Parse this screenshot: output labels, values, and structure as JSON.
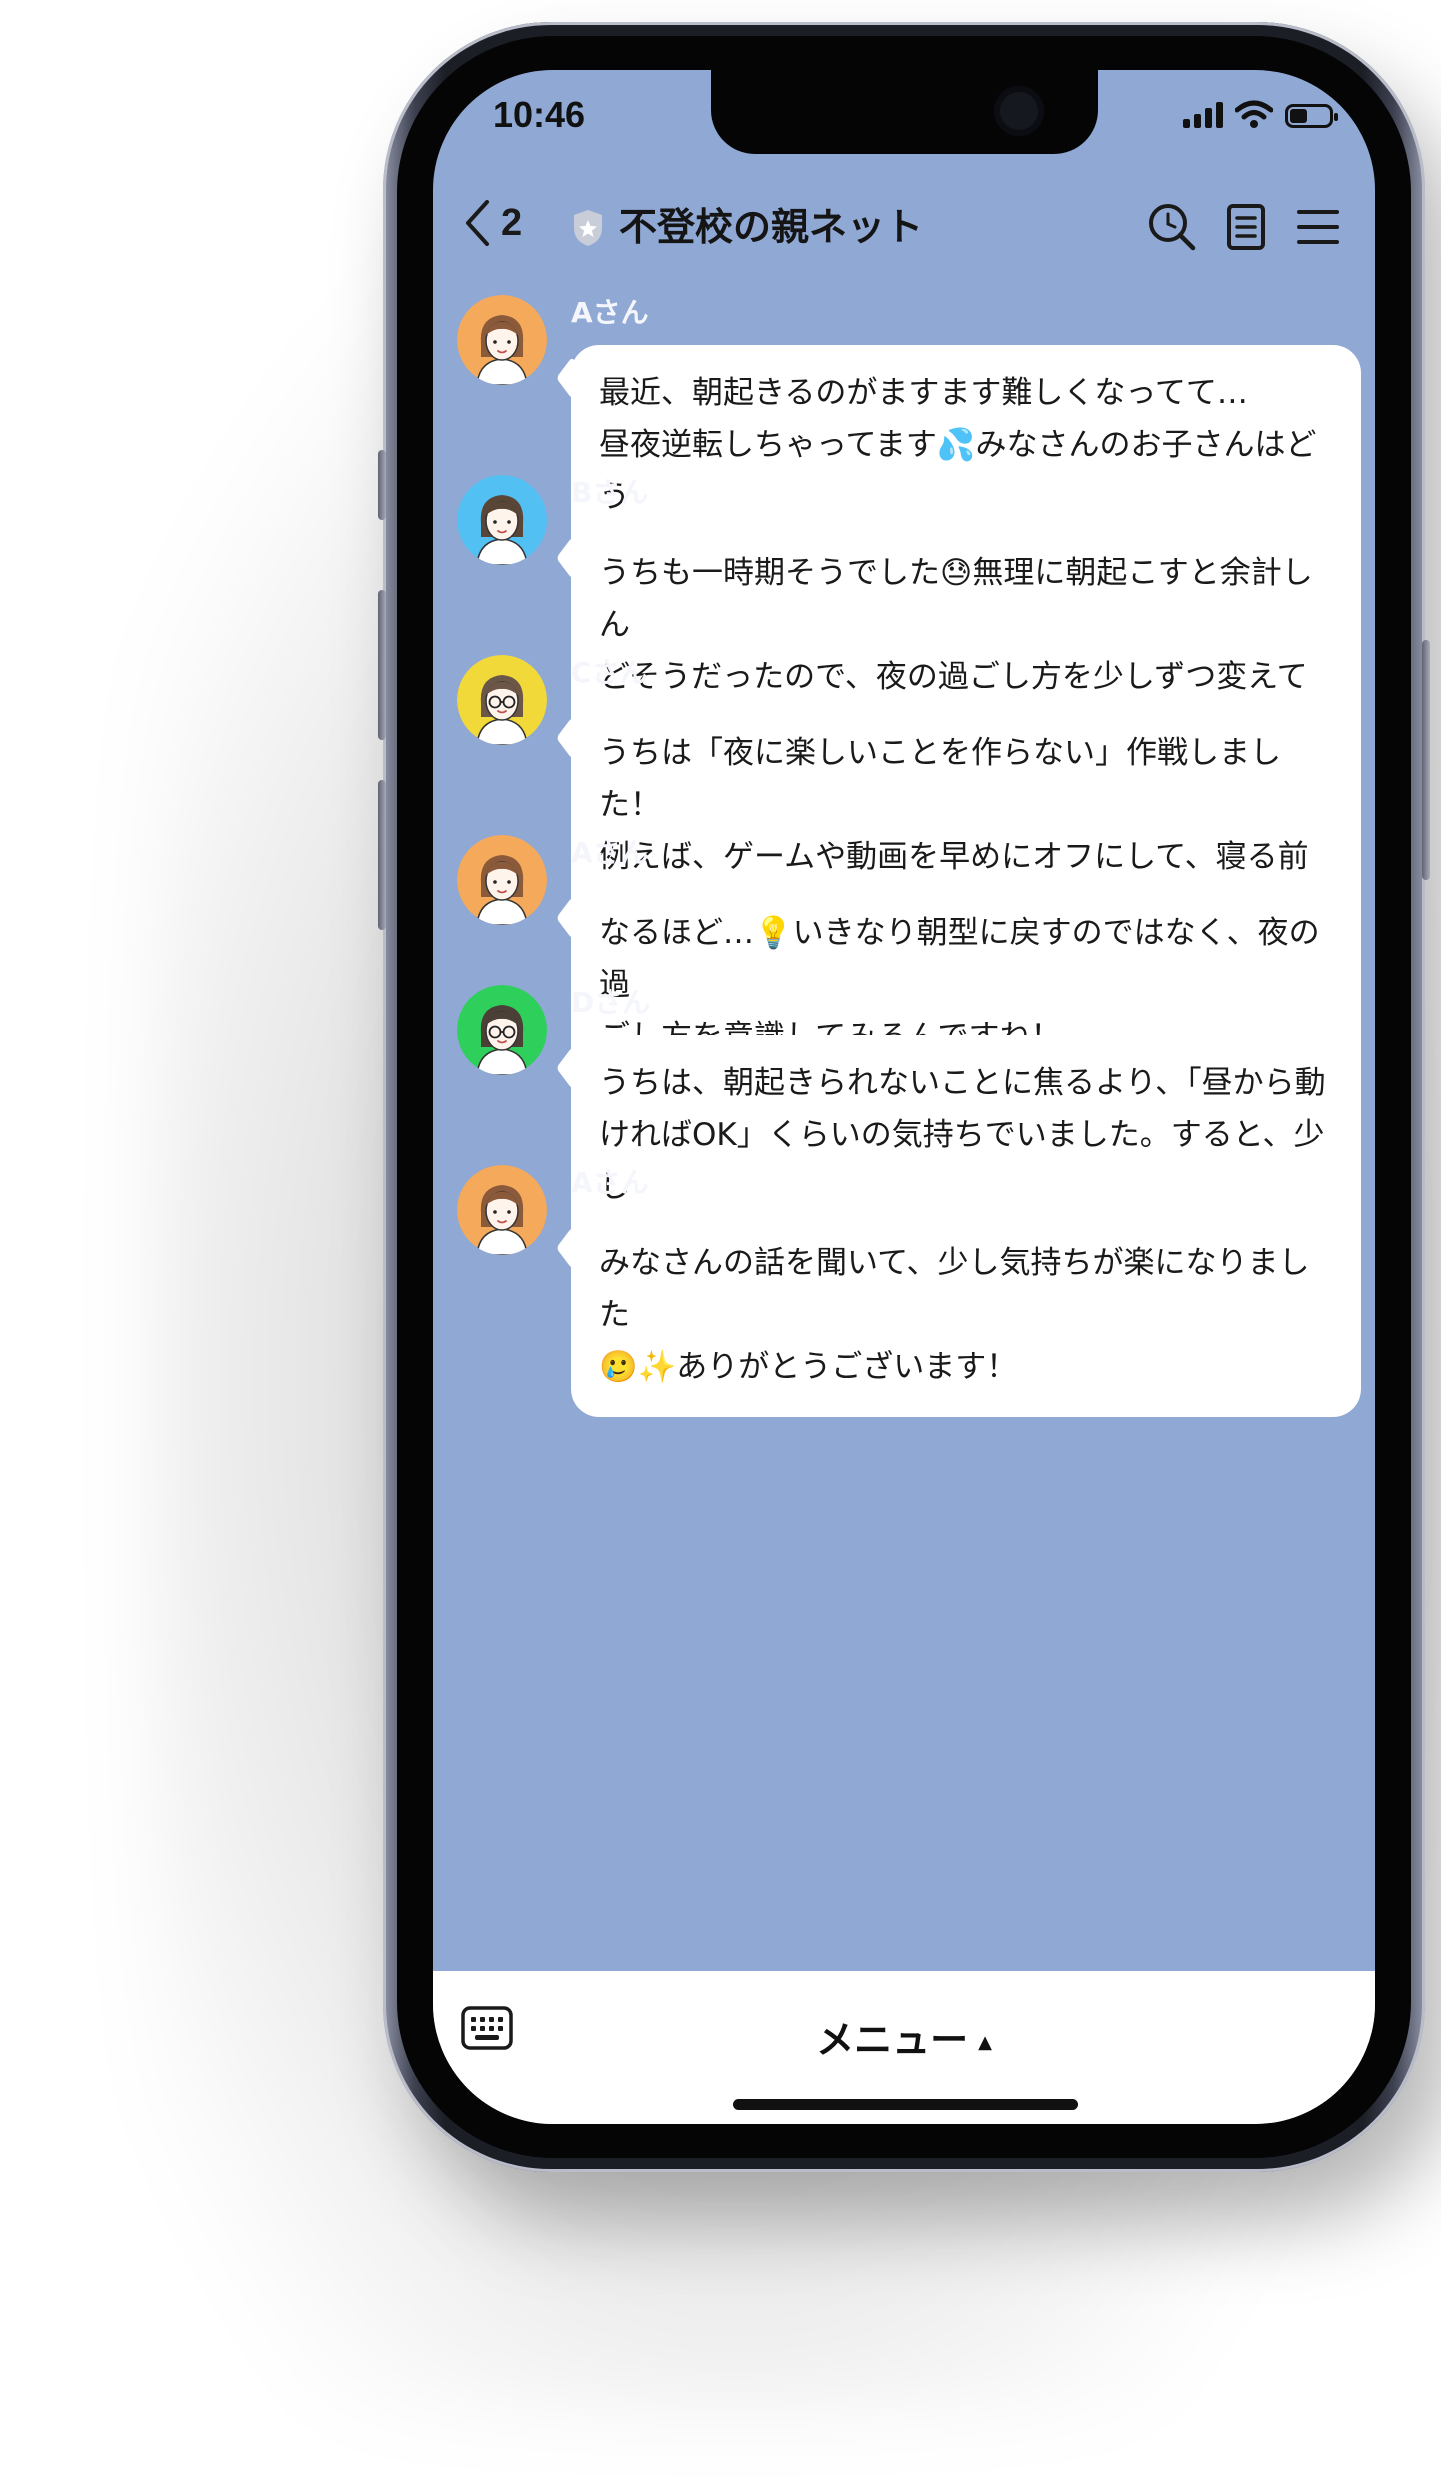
{
  "status_bar": {
    "time": "10:46",
    "battery_level": 0.45
  },
  "header": {
    "back_count": "2",
    "group_name": "不登校の親ネット",
    "icons": [
      "search-icon",
      "notes-icon",
      "hamburger-menu-icon"
    ]
  },
  "messages": [
    {
      "sender": "Aさん",
      "avatar_color": "#f5a95a",
      "text": "最近、朝起きるのがますます難しくなってて…\n昼夜逆転しちゃってます💦みなさんのお子さんはどう\nしてますか？"
    },
    {
      "sender": "Bさん",
      "avatar_color": "#52c0f2",
      "text": "うちも一時期そうでした😓無理に朝起こすと余計しん\nどそうだったので、夜の過ごし方を少しずつ変えていき\nました。"
    },
    {
      "sender": "Cさん",
      "avatar_color": "#f2d93a",
      "text": "うちは「夜に楽しいことを作らない」作戦しました！\n例えば、ゲームや動画を早めにオフにして、寝る前にリ\nラックスできるようにしてました。"
    },
    {
      "sender": "Aさん",
      "avatar_color": "#f5a95a",
      "text": "なるほど…💡いきなり朝型に戻すのではなく、夜の過\nごし方を意識してみるんですね！"
    },
    {
      "sender": "Dさん",
      "avatar_color": "#2fcf5c",
      "text": "うちは、朝起きられないことに焦るより、「昼から動\nければOK」くらいの気持ちでいました。すると、少し\nずつ起きる時間が前倒しになってきましたよ。"
    },
    {
      "sender": "Aさん",
      "avatar_color": "#f5a95a",
      "text": "みなさんの話を聞いて、少し気持ちが楽になりました\n🥲✨ありがとうございます！"
    }
  ],
  "footer": {
    "menu_label": "メニュー",
    "menu_arrow": "▲",
    "keyboard_icon": "keyboard-icon"
  }
}
